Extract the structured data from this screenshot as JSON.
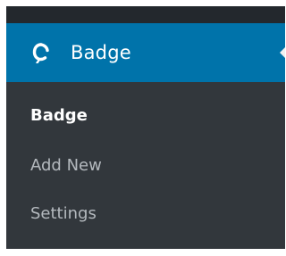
{
  "menu": {
    "label": "Badge",
    "icon": "badge-logo-icon",
    "colors": {
      "active_bg": "#0073aa",
      "submenu_bg": "#32373c",
      "topbar_bg": "#23282d"
    }
  },
  "submenu": {
    "items": [
      {
        "label": "Badge",
        "current": true
      },
      {
        "label": "Add New",
        "current": false
      },
      {
        "label": "Settings",
        "current": false
      }
    ]
  }
}
